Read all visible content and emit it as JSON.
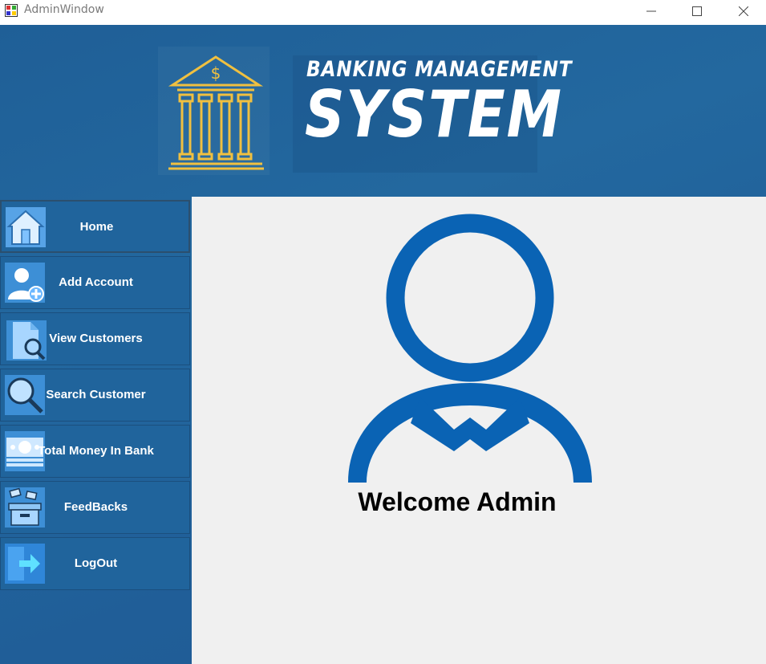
{
  "window": {
    "title": "AdminWindow",
    "controls": {
      "minimize": "minimize-icon",
      "maximize": "maximize-icon",
      "close": "close-icon"
    }
  },
  "banner": {
    "line1": "BANKING MANAGEMENT",
    "line2": "SYSTEM",
    "logo_icon": "bank-building-icon"
  },
  "sidebar": {
    "items": [
      {
        "label": "Home",
        "icon": "home-icon",
        "active": true
      },
      {
        "label": "Add Account",
        "icon": "add-user-icon"
      },
      {
        "label": "View Customers",
        "icon": "document-search-icon"
      },
      {
        "label": "Search Customer",
        "icon": "magnifier-icon"
      },
      {
        "label": "Total Money In Bank",
        "icon": "money-icon"
      },
      {
        "label": "FeedBacks",
        "icon": "mailbox-icon"
      },
      {
        "label": "LogOut",
        "icon": "logout-arrow-icon"
      }
    ]
  },
  "main": {
    "welcome_text": "Welcome Admin",
    "avatar_icon": "user-avatar-icon"
  },
  "colors": {
    "header_blue": "#22649c",
    "panel_bg": "#f0f0f0",
    "avatar_blue": "#0a63b4",
    "logo_gold": "#f0c040"
  }
}
